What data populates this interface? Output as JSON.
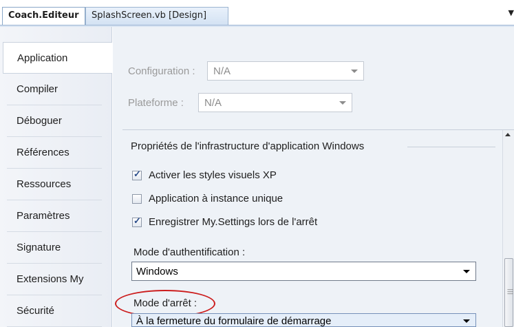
{
  "tabs": {
    "active": "Coach.Editeur",
    "inactive": "SplashScreen.vb [Design]",
    "overflow": "▼"
  },
  "nav": {
    "items": [
      {
        "label": "Application"
      },
      {
        "label": "Compiler"
      },
      {
        "label": "Déboguer"
      },
      {
        "label": "Références"
      },
      {
        "label": "Ressources"
      },
      {
        "label": "Paramètres"
      },
      {
        "label": "Signature"
      },
      {
        "label": "Extensions My"
      },
      {
        "label": "Sécurité"
      }
    ],
    "selected_index": 0
  },
  "content": {
    "configuration_label": "Configuration :",
    "configuration_value": "N/A",
    "platform_label": "Plateforme :",
    "platform_value": "N/A",
    "section_title": "Propriétés de l'infrastructure d'application Windows",
    "checkboxes": [
      {
        "label": "Activer les styles visuels XP",
        "checked": true
      },
      {
        "label": "Application à instance unique",
        "checked": false
      },
      {
        "label": "Enregistrer My.Settings lors de l'arrêt",
        "checked": true
      }
    ],
    "auth_mode_label": "Mode d'authentification :",
    "auth_mode_value": "Windows",
    "stop_mode_label": "Mode d'arrêt :",
    "stop_mode_value": "À la fermeture du formulaire de démarrage"
  },
  "colors": {
    "annotation_ellipse": "#cc1d1d",
    "selected_nav_bg": "#ffffff",
    "content_bg": "#eef2f7"
  },
  "icons": {
    "checkbox_checked": "check-icon",
    "combo_dropdown": "chevron-down-icon",
    "scroll_up": "arrow-up-icon"
  }
}
